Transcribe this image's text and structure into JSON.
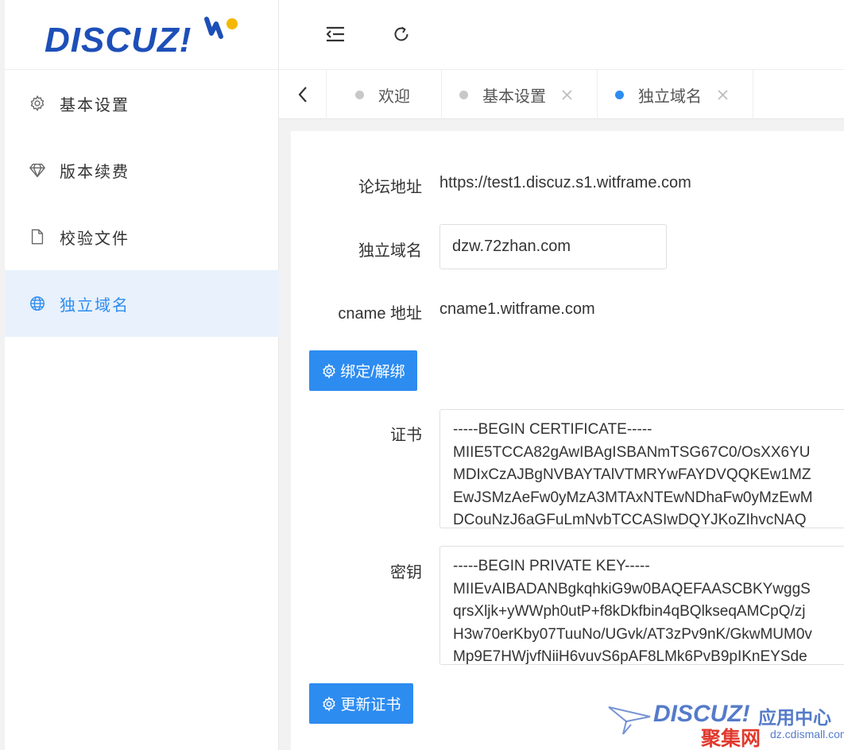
{
  "logo": {
    "text": "DISCUZ!"
  },
  "sidebar": {
    "items": [
      {
        "label": "基本设置",
        "icon": "gear-icon"
      },
      {
        "label": "版本续费",
        "icon": "diamond-icon"
      },
      {
        "label": "校验文件",
        "icon": "file-icon"
      },
      {
        "label": "独立域名",
        "icon": "globe-icon",
        "active": true
      }
    ]
  },
  "header": {
    "collapse_icon": "menu-collapse-icon",
    "refresh_icon": "refresh-icon"
  },
  "tabs": {
    "items": [
      {
        "label": "欢迎",
        "closable": false
      },
      {
        "label": "基本设置",
        "closable": true
      },
      {
        "label": "独立域名",
        "closable": true,
        "active": true
      }
    ]
  },
  "form": {
    "forum_label": "论坛地址",
    "forum_value": "https://test1.discuz.s1.witframe.com",
    "domain_label": "独立域名",
    "domain_value": "dzw.72zhan.com",
    "cname_label": "cname 地址",
    "cname_value": "cname1.witframe.com",
    "bind_button": "绑定/解绑",
    "cert_label": "证书",
    "cert_value": "-----BEGIN CERTIFICATE-----\nMIIE5TCCA82gAwIBAgISBANmTSG67C0/OsXX6YU\nMDIxCzAJBgNVBAYTAlVTMRYwFAYDVQQKEw1MZ\nEwJSMzAeFw0yMzA3MTAxNTEwNDhaFw0yMzEwM\nDCouNzJ6aGFuLmNvbTCCASIwDQYJKoZIhvcNAQ",
    "key_label": "密钥",
    "key_value": "-----BEGIN PRIVATE KEY-----\nMIIEvAIBADANBgkqhkiG9w0BAQEFAASCBKYwggS\nqrsXljk+yWWph0utP+f8kDkfbin4qBQlkseqAMCpQ/zj\nH3w70erKby07TuuNo/UGvk/AT3zPv9nK/GkwMUM0v\nMp9E7HWjvfNiiH6vuvS6pAF8LMk6PvB9pIKnEYSde",
    "update_button": "更新证书"
  },
  "watermark": {
    "brand": "DISCUZ!",
    "cn_top": "应用中心",
    "cn_bottom": "聚集网",
    "url": "dz.cdismall.com"
  },
  "colors": {
    "accent": "#2d8cf0",
    "brand": "#1d4fb8",
    "active_bg": "#e8f1fc"
  }
}
